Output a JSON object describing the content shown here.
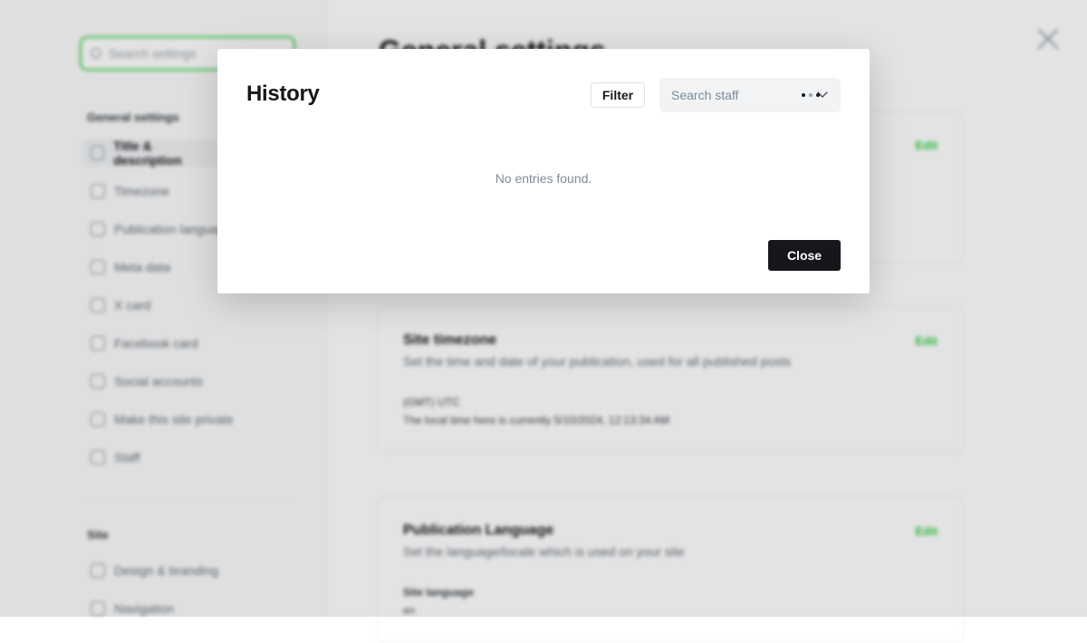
{
  "background": {
    "search_placeholder": "Search settings",
    "page_title": "General settings",
    "sidebar": {
      "heading_general": "General settings",
      "general_items": [
        {
          "label": "Title & description",
          "icon": "text-icon"
        },
        {
          "label": "Timezone",
          "icon": "globe-icon"
        },
        {
          "label": "Publication language",
          "icon": "language-icon"
        },
        {
          "label": "Meta data",
          "icon": "database-icon"
        },
        {
          "label": "X card",
          "icon": "x-logo-icon"
        },
        {
          "label": "Facebook card",
          "icon": "facebook-icon"
        },
        {
          "label": "Social accounts",
          "icon": "hand-icon"
        },
        {
          "label": "Make this site private",
          "icon": "lock-icon"
        },
        {
          "label": "Staff",
          "icon": "users-icon"
        }
      ],
      "heading_site": "Site",
      "site_items": [
        {
          "label": "Design & branding",
          "icon": "brush-icon"
        },
        {
          "label": "Navigation",
          "icon": "menu-icon"
        }
      ]
    },
    "cards": [
      {
        "title": "",
        "description": "",
        "edit_label": "Edit"
      },
      {
        "title": "Site timezone",
        "description": "Set the time and date of your publication, used for all published posts",
        "value": "(GMT) UTC",
        "note": "The local time here is currently 5/10/2024, 12:13:34 AM",
        "edit_label": "Edit"
      },
      {
        "title": "Publication Language",
        "description": "Set the language/locale which is used on your site",
        "value_label": "Site language",
        "value": "en",
        "edit_label": "Edit"
      }
    ]
  },
  "modal": {
    "title": "History",
    "filter_label": "Filter",
    "staff_search_placeholder": "Search staff",
    "empty_message": "No entries found.",
    "close_label": "Close"
  }
}
